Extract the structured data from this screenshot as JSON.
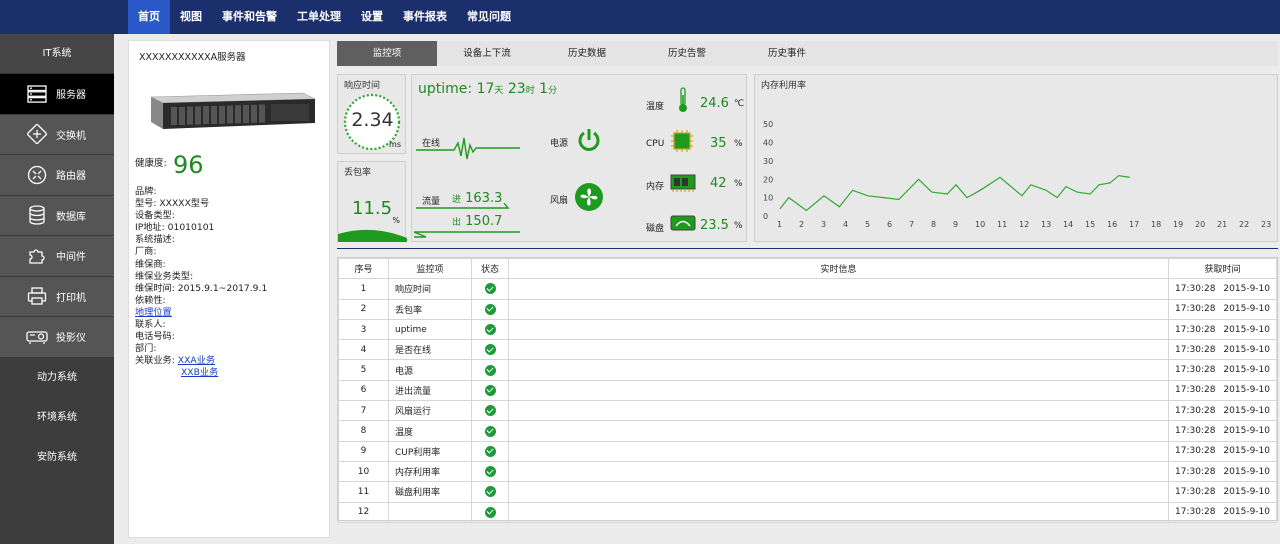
{
  "nav": {
    "items": [
      "首页",
      "视图",
      "事件和告警",
      "工单处理",
      "设置",
      "事件报表",
      "常见问题"
    ]
  },
  "sidebar": {
    "group": "IT系统",
    "items": [
      {
        "label": "服务器",
        "icon": "server-icon"
      },
      {
        "label": "交换机",
        "icon": "switch-icon"
      },
      {
        "label": "路由器",
        "icon": "router-icon"
      },
      {
        "label": "数据库",
        "icon": "database-icon"
      },
      {
        "label": "中间件",
        "icon": "middleware-icon"
      },
      {
        "label": "打印机",
        "icon": "printer-icon"
      },
      {
        "label": "投影仪",
        "icon": "projector-icon"
      }
    ],
    "lower": [
      "动力系统",
      "环境系统",
      "安防系统"
    ]
  },
  "info": {
    "title": "XXXXXXXXXXXA服务器",
    "health_label": "健康度:",
    "health_value": "96",
    "brand": "品牌:",
    "model": "型号: XXXXX型号",
    "device_type": "设备类型:",
    "ip": "IP地址: 01010101",
    "desc": "系统描述:",
    "vendor": "厂商:",
    "maint_vendor": "维保商:",
    "maint_type": "维保业务类型:",
    "maint_time": "维保时间: 2015.9.1~2017.9.1",
    "dependency": "依赖性:",
    "location": "地理位置",
    "contact": "联系人:",
    "phone": "电话号码:",
    "dept": "部门:",
    "biz_label": "关联业务:",
    "biz1": "XXA业务",
    "biz2": "XXB业务"
  },
  "tabs": [
    "监控项",
    "设备上下流",
    "历史数据",
    "历史告警",
    "历史事件"
  ],
  "response": {
    "label": "响应时间",
    "value": "2.34",
    "unit": "ms"
  },
  "packetloss": {
    "label": "丢包率",
    "value": "11.5",
    "unit": "%"
  },
  "status": {
    "uptime_label": "uptime:",
    "days": "17",
    "days_unit": "天",
    "hours": "23",
    "hours_unit": "时",
    "mins": "1",
    "mins_unit": "分",
    "online": "在线",
    "traffic": "流量",
    "in_label": "进",
    "in_value": "163.3",
    "out_label": "出",
    "out_value": "150.7",
    "power": "电源",
    "fan": "风扇",
    "temp_label": "温度",
    "temp_value": "24.6",
    "temp_unit": "℃",
    "cpu_label": "CPU",
    "cpu_value": "35",
    "cpu_unit": "%",
    "mem_label": "内存",
    "mem_value": "42",
    "mem_unit": "%",
    "disk_label": "磁盘",
    "disk_value": "23.5",
    "disk_unit": "%"
  },
  "colors": {
    "accent": "#1e8a1e",
    "nav": "#1b2f6d",
    "nav_active": "#2b58c8"
  },
  "chart_data": {
    "type": "line",
    "title": "内存利用率",
    "x": [
      1,
      2,
      3,
      4,
      5,
      6,
      7,
      8,
      9,
      10,
      11,
      12,
      13,
      14,
      15,
      16,
      17,
      18,
      19,
      20,
      21,
      22,
      23,
      24
    ],
    "x_ticks": [
      "1",
      "2",
      "3",
      "4",
      "5",
      "6",
      "7",
      "8",
      "9",
      "10",
      "11",
      "12",
      "13",
      "14",
      "15",
      "16",
      "17",
      "18",
      "19",
      "20",
      "21",
      "22",
      "23",
      "24"
    ],
    "y_ticks": [
      "0",
      "10",
      "20",
      "30",
      "40",
      "50"
    ],
    "ylim": [
      0,
      55
    ],
    "series": [
      {
        "values": [
          4,
          10,
          3,
          11,
          5,
          14,
          11,
          10,
          9,
          20,
          13,
          12,
          17,
          10,
          14,
          21,
          16,
          11,
          17,
          14,
          10,
          16,
          13,
          12,
          17,
          18,
          22,
          21
        ]
      }
    ],
    "series_x": [
      0.6,
      1,
      1.8,
      2.6,
      3.3,
      3.9,
      4.6,
      5.3,
      6,
      6.9,
      7.5,
      8.2,
      8.6,
      9.1,
      9.7,
      10.6,
      11.1,
      11.6,
      12,
      12.7,
      13.2,
      13.6,
      14.1,
      14.7,
      15.1,
      15.6,
      16,
      16.5
    ],
    "line_color": "#33a833",
    "grid": false
  },
  "table": {
    "headers": [
      "序号",
      "监控项",
      "状态",
      "实时信息",
      "获取时间"
    ],
    "rows": [
      {
        "no": "1",
        "item": "响应时间",
        "time": "17:30:28",
        "date": "2015-9-10"
      },
      {
        "no": "2",
        "item": "丢包率",
        "time": "17:30:28",
        "date": "2015-9-10"
      },
      {
        "no": "3",
        "item": "uptime",
        "time": "17:30:28",
        "date": "2015-9-10"
      },
      {
        "no": "4",
        "item": "是否在线",
        "time": "17:30:28",
        "date": "2015-9-10"
      },
      {
        "no": "5",
        "item": "电源",
        "time": "17:30:28",
        "date": "2015-9-10"
      },
      {
        "no": "6",
        "item": "进出流量",
        "time": "17:30:28",
        "date": "2015-9-10"
      },
      {
        "no": "7",
        "item": "风扇运行",
        "time": "17:30:28",
        "date": "2015-9-10"
      },
      {
        "no": "8",
        "item": "温度",
        "time": "17:30:28",
        "date": "2015-9-10"
      },
      {
        "no": "9",
        "item": "CUP利用率",
        "time": "17:30:28",
        "date": "2015-9-10"
      },
      {
        "no": "10",
        "item": "内存利用率",
        "time": "17:30:28",
        "date": "2015-9-10"
      },
      {
        "no": "11",
        "item": "磁盘利用率",
        "time": "17:30:28",
        "date": "2015-9-10"
      },
      {
        "no": "12",
        "item": "",
        "time": "17:30:28",
        "date": "2015-9-10"
      }
    ]
  }
}
